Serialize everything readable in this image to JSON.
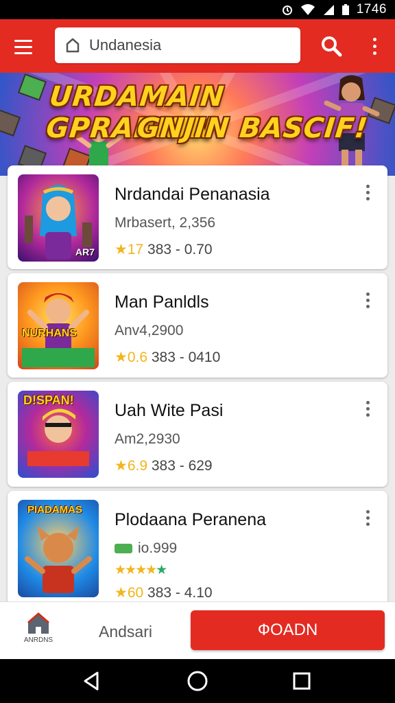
{
  "status_bar": {
    "time": "1746"
  },
  "search": {
    "value": "Undanesia"
  },
  "banner": {
    "line1": "URDAMAIN GPRARNIN",
    "line2": "GNJIN BASCIF!"
  },
  "apps": [
    {
      "name": "Nrdandai Penanasia",
      "subtitle": "Mrbasert, 2,356",
      "rating": "17",
      "meta": "383 - 0.70",
      "thumb_label": "AR7",
      "colors": [
        "#6a1fa8",
        "#ff8a3d"
      ]
    },
    {
      "name": "Man Panldls",
      "subtitle": "Anv4,2900",
      "rating": "0.6",
      "meta": "383 - 0410",
      "thumb_label": "NURHANS",
      "colors": [
        "#ffb11f",
        "#d93a1c"
      ]
    },
    {
      "name": "Uah Wite Pasi",
      "subtitle": "Am2,2930",
      "rating": "6.9",
      "meta": "383 - 629",
      "thumb_label": "D!SPAN!",
      "colors": [
        "#2a4fd1",
        "#e63b2e"
      ]
    },
    {
      "name": "Plodaana Peranena",
      "subtitle": "io.999",
      "rating": "60",
      "meta": "383 - 4.10",
      "thumb_label": "PIADAMAS",
      "colors": [
        "#1f8ae6",
        "#f0a53a"
      ]
    }
  ],
  "bottom_bar": {
    "home_label": "ANRDNS",
    "secondary_label": "Andsari",
    "primary_label": "ФOADN"
  },
  "colors": {
    "accent": "#e32b22",
    "star": "#f2b51c"
  }
}
